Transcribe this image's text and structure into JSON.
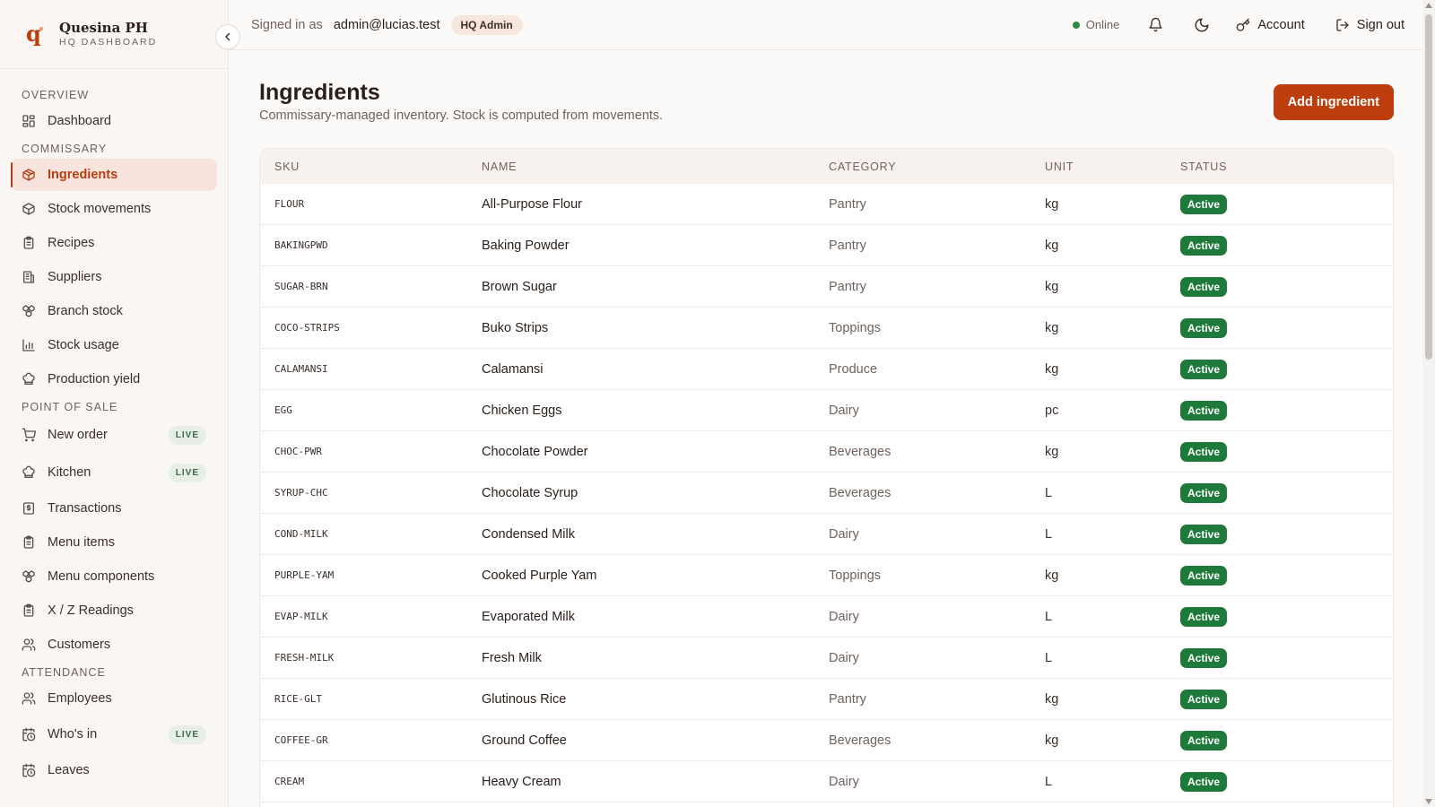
{
  "brand": {
    "name": "Quesina PH",
    "subtitle": "HQ DASHBOARD"
  },
  "colors": {
    "accent": "#bd3d0c",
    "status_active": "#1e7a3a",
    "online": "#2f8a47"
  },
  "sidebar": {
    "sections": [
      {
        "title": "OVERVIEW",
        "items": [
          {
            "label": "Dashboard",
            "icon": "dashboard-icon"
          }
        ]
      },
      {
        "title": "COMMISSARY",
        "items": [
          {
            "label": "Ingredients",
            "icon": "package-icon",
            "active": true
          },
          {
            "label": "Stock movements",
            "icon": "box-icon"
          },
          {
            "label": "Recipes",
            "icon": "clipboard-icon"
          },
          {
            "label": "Suppliers",
            "icon": "building-icon"
          },
          {
            "label": "Branch stock",
            "icon": "boxes-icon"
          },
          {
            "label": "Stock usage",
            "icon": "bar-chart-icon"
          },
          {
            "label": "Production yield",
            "icon": "chef-hat-icon"
          }
        ]
      },
      {
        "title": "POINT OF SALE",
        "items": [
          {
            "label": "New order",
            "icon": "cart-icon",
            "badge": "LIVE"
          },
          {
            "label": "Kitchen",
            "icon": "chef-hat-icon",
            "badge": "LIVE"
          },
          {
            "label": "Transactions",
            "icon": "receipt-icon"
          },
          {
            "label": "Menu items",
            "icon": "clipboard-icon"
          },
          {
            "label": "Menu components",
            "icon": "boxes-icon"
          },
          {
            "label": "X / Z Readings",
            "icon": "clipboard-icon"
          },
          {
            "label": "Customers",
            "icon": "users-icon"
          }
        ]
      },
      {
        "title": "ATTENDANCE",
        "items": [
          {
            "label": "Employees",
            "icon": "users-icon"
          },
          {
            "label": "Who's in",
            "icon": "calendar-clock-icon",
            "badge": "LIVE"
          },
          {
            "label": "Leaves",
            "icon": "calendar-clock-icon"
          }
        ]
      }
    ]
  },
  "topbar": {
    "signed_in_label": "Signed in as",
    "email": "admin@lucias.test",
    "role": "HQ Admin",
    "status": "Online",
    "account_label": "Account",
    "signout_label": "Sign out"
  },
  "page": {
    "title": "Ingredients",
    "subtitle": "Commissary-managed inventory. Stock is computed from movements.",
    "add_button": "Add ingredient"
  },
  "table": {
    "columns": [
      "SKU",
      "NAME",
      "CATEGORY",
      "UNIT",
      "STATUS"
    ],
    "rows": [
      {
        "sku": "FLOUR",
        "name": "All-Purpose Flour",
        "category": "Pantry",
        "unit": "kg",
        "status": "Active"
      },
      {
        "sku": "BAKINGPWD",
        "name": "Baking Powder",
        "category": "Pantry",
        "unit": "kg",
        "status": "Active"
      },
      {
        "sku": "SUGAR-BRN",
        "name": "Brown Sugar",
        "category": "Pantry",
        "unit": "kg",
        "status": "Active"
      },
      {
        "sku": "COCO-STRIPS",
        "name": "Buko Strips",
        "category": "Toppings",
        "unit": "kg",
        "status": "Active"
      },
      {
        "sku": "CALAMANSI",
        "name": "Calamansi",
        "category": "Produce",
        "unit": "kg",
        "status": "Active"
      },
      {
        "sku": "EGG",
        "name": "Chicken Eggs",
        "category": "Dairy",
        "unit": "pc",
        "status": "Active"
      },
      {
        "sku": "CHOC-PWR",
        "name": "Chocolate Powder",
        "category": "Beverages",
        "unit": "kg",
        "status": "Active"
      },
      {
        "sku": "SYRUP-CHC",
        "name": "Chocolate Syrup",
        "category": "Beverages",
        "unit": "L",
        "status": "Active"
      },
      {
        "sku": "COND-MILK",
        "name": "Condensed Milk",
        "category": "Dairy",
        "unit": "L",
        "status": "Active"
      },
      {
        "sku": "PURPLE-YAM",
        "name": "Cooked Purple Yam",
        "category": "Toppings",
        "unit": "kg",
        "status": "Active"
      },
      {
        "sku": "EVAP-MILK",
        "name": "Evaporated Milk",
        "category": "Dairy",
        "unit": "L",
        "status": "Active"
      },
      {
        "sku": "FRESH-MILK",
        "name": "Fresh Milk",
        "category": "Dairy",
        "unit": "L",
        "status": "Active"
      },
      {
        "sku": "RICE-GLT",
        "name": "Glutinous Rice",
        "category": "Pantry",
        "unit": "kg",
        "status": "Active"
      },
      {
        "sku": "COFFEE-GR",
        "name": "Ground Coffee",
        "category": "Beverages",
        "unit": "kg",
        "status": "Active"
      },
      {
        "sku": "CREAM",
        "name": "Heavy Cream",
        "category": "Dairy",
        "unit": "L",
        "status": "Active"
      }
    ]
  }
}
